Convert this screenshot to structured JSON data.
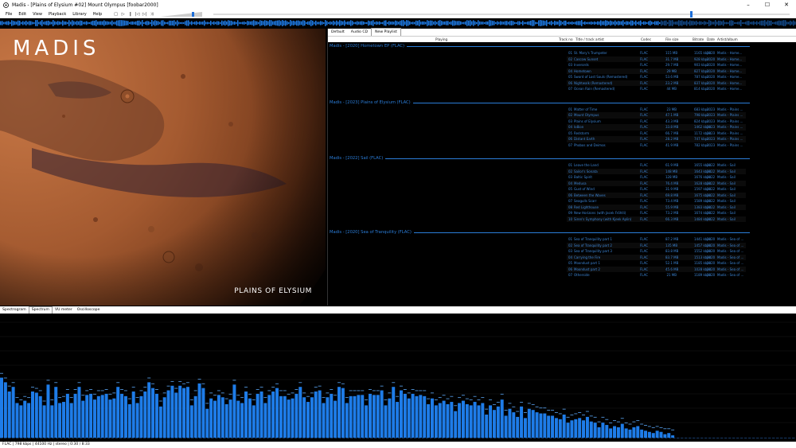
{
  "window": {
    "title": "Madis - [Plains of Elysium #02] Mount Olympus  [foobar2000]",
    "minimize": "–",
    "maximize": "☐",
    "close": "✕"
  },
  "menu": [
    "File",
    "Edit",
    "View",
    "Playback",
    "Library",
    "Help"
  ],
  "toolbar": {
    "buttons": [
      "stop-icon",
      "play-icon",
      "pause-icon",
      "previous-icon",
      "next-icon",
      "random-icon"
    ],
    "glyphs": [
      "□",
      "▷",
      "‖",
      "|◁",
      "▷|",
      "⤨"
    ],
    "volume_level": 0.8,
    "seek_position": 0.83
  },
  "colors": {
    "accent": "#2b7dd8",
    "text_blue": "#3d86d6",
    "spectrum_bar": "#1e7ce8",
    "background": "#000000"
  },
  "art": {
    "logo": "MADIS",
    "caption": "PLAINS OF ELYSIUM"
  },
  "playlist": {
    "tabs": [
      {
        "label": "Default",
        "active": false
      },
      {
        "label": "Audio CD",
        "active": false
      },
      {
        "label": "New Playlist",
        "active": true
      }
    ],
    "columns": {
      "playing": "Playing",
      "track_no": "Track no",
      "title": "Title / track artist",
      "codec": "Codec",
      "size": "File size",
      "bitrate": "Bitrate",
      "date": "Date",
      "artist": "Artist/album"
    },
    "groups": [
      {
        "header": "Madis - [2020] Hometown EP (FLAC)",
        "tracks": [
          {
            "no": "01",
            "title": "St. Mary's Trumpeter",
            "codec": "FLAC",
            "size": "115 MB",
            "bitrate": "1165 kbps",
            "date": "2020",
            "artist": "Madis - Home..."
          },
          {
            "no": "02",
            "title": "Cascow Sunset",
            "codec": "FLAC",
            "size": "31.7 MB",
            "bitrate": "928 kbps",
            "date": "2020",
            "artist": "Madis - Home..."
          },
          {
            "no": "03",
            "title": "Inverords",
            "codec": "FLAC",
            "size": "29.7 MB",
            "bitrate": "903 kbps",
            "date": "2020",
            "artist": "Madis - Home..."
          },
          {
            "no": "04",
            "title": "Hometown",
            "codec": "FLAC",
            "size": "29 MB",
            "bitrate": "827 kbps",
            "date": "2020",
            "artist": "Madis - Home..."
          },
          {
            "no": "05",
            "title": "Sword of Lost Souls (Remastered)",
            "codec": "FLAC",
            "size": "53.6 MB",
            "bitrate": "787 kbps",
            "date": "2020",
            "artist": "Madis - Home..."
          },
          {
            "no": "06",
            "title": "Nightwalk (Remastered)",
            "codec": "FLAC",
            "size": "23.2 MB",
            "bitrate": "837 kbps",
            "date": "2020",
            "artist": "Madis - Home..."
          },
          {
            "no": "07",
            "title": "Ocean Rain (Remastered)",
            "codec": "FLAC",
            "size": "44 MB",
            "bitrate": "814 kbps",
            "date": "2020",
            "artist": "Madis - Home..."
          }
        ]
      },
      {
        "header": "Madis - [2023] Plains of Elysium (FLAC)",
        "tracks": [
          {
            "no": "01",
            "title": "Matter of Time",
            "codec": "FLAC",
            "size": "23 MB",
            "bitrate": "683 kbps",
            "date": "2023",
            "artist": "Madis - Plains ..."
          },
          {
            "no": "02",
            "title": "Mount Olympus",
            "codec": "FLAC",
            "size": "47.1 MB",
            "bitrate": "798 kbps",
            "date": "2023",
            "artist": "Madis - Plains ..."
          },
          {
            "no": "03",
            "title": "Plains of Elysium",
            "codec": "FLAC",
            "size": "43.3 MB",
            "bitrate": "824 kbps",
            "date": "2023",
            "artist": "Madis - Plains ..."
          },
          {
            "no": "04",
            "title": "Io8ion",
            "codec": "FLAC",
            "size": "33.8 MB",
            "bitrate": "1462 kbps",
            "date": "2023",
            "artist": "Madis - Plains ..."
          },
          {
            "no": "05",
            "title": "Redstorm",
            "codec": "FLAC",
            "size": "66.7 MB",
            "bitrate": "1172 kbps",
            "date": "2023",
            "artist": "Madis - Plains ..."
          },
          {
            "no": "06",
            "title": "Distant Earth",
            "codec": "FLAC",
            "size": "28.2 MB",
            "bitrate": "747 kbps",
            "date": "2023",
            "artist": "Madis - Plains ..."
          },
          {
            "no": "07",
            "title": "Phobos and Deimos",
            "codec": "FLAC",
            "size": "41.9 MB",
            "bitrate": "782 kbps",
            "date": "2023",
            "artist": "Madis - Plains ..."
          }
        ]
      },
      {
        "header": "Madis - [2022] Sail (FLAC)",
        "tracks": [
          {
            "no": "01",
            "title": "Leave the Land",
            "codec": "FLAC",
            "size": "61.9 MB",
            "bitrate": "1655 kbps",
            "date": "2022",
            "artist": "Madis - Sail"
          },
          {
            "no": "02",
            "title": "Sailor's Sonata",
            "codec": "FLAC",
            "size": "148 MB",
            "bitrate": "1643 kbps",
            "date": "2022",
            "artist": "Madis - Sail"
          },
          {
            "no": "03",
            "title": "Baltic Spirit",
            "codec": "FLAC",
            "size": "128 MB",
            "bitrate": "1676 kbps",
            "date": "2022",
            "artist": "Madis - Sail"
          },
          {
            "no": "04",
            "title": "Medusa",
            "codec": "FLAC",
            "size": "76.4 MB",
            "bitrate": "1628 kbps",
            "date": "2022",
            "artist": "Madis - Sail"
          },
          {
            "no": "05",
            "title": "Gust of Wind",
            "codec": "FLAC",
            "size": "31.9 MB",
            "bitrate": "1597 kbps",
            "date": "2022",
            "artist": "Madis - Sail"
          },
          {
            "no": "06",
            "title": "Between the Waves",
            "codec": "FLAC",
            "size": "69.8 MB",
            "bitrate": "1675 kbps",
            "date": "2022",
            "artist": "Madis - Sail"
          },
          {
            "no": "07",
            "title": "Seagulls Scarr",
            "codec": "FLAC",
            "size": "73.4 MB",
            "bitrate": "1589 kbps",
            "date": "2022",
            "artist": "Madis - Sail"
          },
          {
            "no": "08",
            "title": "Red Lighthouse",
            "codec": "FLAC",
            "size": "55.9 MB",
            "bitrate": "1383 kbps",
            "date": "2022",
            "artist": "Madis - Sail"
          },
          {
            "no": "09",
            "title": "New Horizons (with Jacek Fröhlli)",
            "codec": "FLAC",
            "size": "73.2 MB",
            "bitrate": "1674 kbps",
            "date": "2022",
            "artist": "Madis - Sail"
          },
          {
            "no": "10",
            "title": "Siren's Symphony (with Kjeek Aplin)",
            "codec": "FLAC",
            "size": "66.3 MB",
            "bitrate": "1484 kbps",
            "date": "2022",
            "artist": "Madis - Sail"
          }
        ]
      },
      {
        "header": "Madis - [2020] Sea of Tranquility (FLAC)",
        "tracks": [
          {
            "no": "01",
            "title": "Sea of Tranquility part 1",
            "codec": "FLAC",
            "size": "87.2 MB",
            "bitrate": "1441 kbps",
            "date": "2020",
            "artist": "Madis - Sea of ..."
          },
          {
            "no": "02",
            "title": "Sea of Tranquility part 2",
            "codec": "FLAC",
            "size": "135 MB",
            "bitrate": "1457 kbps",
            "date": "2020",
            "artist": "Madis - Sea of ..."
          },
          {
            "no": "03",
            "title": "Sea of Tranquility part 3",
            "codec": "FLAC",
            "size": "83.8 MB",
            "bitrate": "1552 kbps",
            "date": "2020",
            "artist": "Madis - Sea of ..."
          },
          {
            "no": "04",
            "title": "Carrying the Fire",
            "codec": "FLAC",
            "size": "83.7 MB",
            "bitrate": "1513 kbps",
            "date": "2020",
            "artist": "Madis - Sea of ..."
          },
          {
            "no": "05",
            "title": "Moondust part 1",
            "codec": "FLAC",
            "size": "52.1 MB",
            "bitrate": "1185 kbps",
            "date": "2020",
            "artist": "Madis - Sea of ..."
          },
          {
            "no": "06",
            "title": "Moondust part 2",
            "codec": "FLAC",
            "size": "45.6 MB",
            "bitrate": "1028 kbps",
            "date": "2020",
            "artist": "Madis - Sea of ..."
          },
          {
            "no": "07",
            "title": "Otherside",
            "codec": "FLAC",
            "size": "21 MB",
            "bitrate": "1189 kbps",
            "date": "2020",
            "artist": "Madis - Sea of ..."
          }
        ]
      }
    ]
  },
  "visualization": {
    "tabs": [
      {
        "label": "Spectrogram",
        "active": false
      },
      {
        "label": "Spectrum",
        "active": true
      },
      {
        "label": "VU meter",
        "active": false
      },
      {
        "label": "Oscilloscope",
        "active": false
      }
    ]
  },
  "spectrum": {
    "levels": [
      0.52,
      0.48,
      0.4,
      0.44,
      0.3,
      0.28,
      0.32,
      0.3,
      0.4,
      0.39,
      0.36,
      0.28,
      0.46,
      0.28,
      0.44,
      0.3,
      0.31,
      0.38,
      0.3,
      0.38,
      0.44,
      0.32,
      0.37,
      0.38,
      0.33,
      0.36,
      0.37,
      0.38,
      0.33,
      0.34,
      0.44,
      0.38,
      0.36,
      0.29,
      0.4,
      0.3,
      0.36,
      0.4,
      0.48,
      0.43,
      0.38,
      0.27,
      0.35,
      0.41,
      0.45,
      0.39,
      0.45,
      0.43,
      0.44,
      0.28,
      0.36,
      0.47,
      0.43,
      0.25,
      0.34,
      0.32,
      0.37,
      0.35,
      0.29,
      0.33,
      0.46,
      0.32,
      0.3,
      0.4,
      0.34,
      0.28,
      0.38,
      0.4,
      0.3,
      0.37,
      0.4,
      0.43,
      0.36,
      0.36,
      0.33,
      0.34,
      0.38,
      0.44,
      0.35,
      0.31,
      0.35,
      0.4,
      0.41,
      0.3,
      0.35,
      0.38,
      0.32,
      0.44,
      0.43,
      0.3,
      0.36,
      0.36,
      0.37,
      0.37,
      0.28,
      0.38,
      0.37,
      0.37,
      0.41,
      0.28,
      0.34,
      0.44,
      0.31,
      0.41,
      0.38,
      0.34,
      0.38,
      0.36,
      0.37,
      0.36,
      0.29,
      0.34,
      0.28,
      0.3,
      0.32,
      0.29,
      0.31,
      0.23,
      0.3,
      0.32,
      0.29,
      0.28,
      0.31,
      0.28,
      0.3,
      0.2,
      0.28,
      0.24,
      0.27,
      0.33,
      0.19,
      0.25,
      0.22,
      0.18,
      0.27,
      0.17,
      0.25,
      0.24,
      0.22,
      0.21,
      0.21,
      0.19,
      0.19,
      0.17,
      0.16,
      0.2,
      0.13,
      0.15,
      0.16,
      0.17,
      0.15,
      0.18,
      0.14,
      0.13,
      0.09,
      0.13,
      0.11,
      0.08,
      0.1,
      0.09,
      0.12,
      0.08,
      0.07,
      0.09,
      0.1,
      0.07,
      0.06,
      0.05,
      0.04,
      0.06,
      0.05,
      0.03,
      0.04,
      0.02
    ],
    "peaks": [
      0.56,
      0.52,
      0.45,
      0.48,
      0.35,
      0.33,
      0.36,
      0.35,
      0.44,
      0.43,
      0.41,
      0.32,
      0.5,
      0.33,
      0.48,
      0.35,
      0.36,
      0.42,
      0.35,
      0.42,
      0.48,
      0.37,
      0.41,
      0.42,
      0.38,
      0.41,
      0.41,
      0.42,
      0.38,
      0.39,
      0.48,
      0.42,
      0.41,
      0.34,
      0.44,
      0.35,
      0.41,
      0.44,
      0.52,
      0.47,
      0.42,
      0.32,
      0.39,
      0.45,
      0.49,
      0.43,
      0.49,
      0.47,
      0.48,
      0.33,
      0.41,
      0.51,
      0.47,
      0.3,
      0.39,
      0.37,
      0.41,
      0.39,
      0.34,
      0.38,
      0.5,
      0.37,
      0.35,
      0.44,
      0.38,
      0.33,
      0.42,
      0.44,
      0.35,
      0.41,
      0.44,
      0.47,
      0.41,
      0.41,
      0.38,
      0.39,
      0.42,
      0.48,
      0.39,
      0.36,
      0.39,
      0.44,
      0.45,
      0.35,
      0.39,
      0.42,
      0.37,
      0.48,
      0.47,
      0.35,
      0.41,
      0.41,
      0.41,
      0.41,
      0.33,
      0.42,
      0.41,
      0.41,
      0.45,
      0.33,
      0.39,
      0.48,
      0.36,
      0.45,
      0.42,
      0.39,
      0.42,
      0.41,
      0.41,
      0.41,
      0.34,
      0.39,
      0.33,
      0.35,
      0.37,
      0.34,
      0.36,
      0.28,
      0.35,
      0.37,
      0.34,
      0.33,
      0.36,
      0.33,
      0.35,
      0.25,
      0.33,
      0.29,
      0.31,
      0.38,
      0.24,
      0.3,
      0.27,
      0.23,
      0.31,
      0.22,
      0.3,
      0.29,
      0.27,
      0.26,
      0.26,
      0.24,
      0.24,
      0.22,
      0.21,
      0.25,
      0.18,
      0.2,
      0.21,
      0.22,
      0.2,
      0.23,
      0.19,
      0.18,
      0.14,
      0.18,
      0.16,
      0.13,
      0.15,
      0.14,
      0.17,
      0.13,
      0.12,
      0.14,
      0.15,
      0.12,
      0.11,
      0.1,
      0.09,
      0.1,
      0.09,
      0.08,
      0.08,
      0.07
    ]
  },
  "status": "FLAC | 798 kbps | 44100 Hz | stereo | 0:30 / 8:33"
}
